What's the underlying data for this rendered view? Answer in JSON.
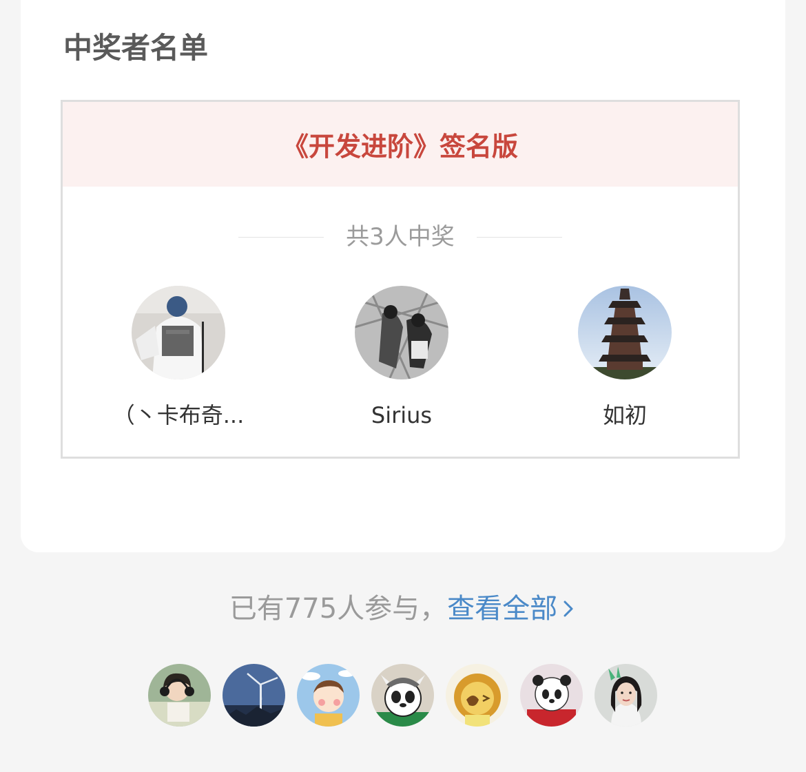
{
  "section_title": "中奖者名单",
  "prize": {
    "name": "《开发进阶》签名版",
    "winner_count_text": "共3人中奖"
  },
  "winners": [
    {
      "name": "（丶卡布奇...",
      "avatar": "avatar-photo-shirt"
    },
    {
      "name": "Sirius",
      "avatar": "avatar-manga-basketball"
    },
    {
      "name": "如初",
      "avatar": "avatar-pagoda"
    }
  ],
  "participation": {
    "text": "已有775人参与，",
    "link_label": "查看全部",
    "link_icon": "chevron-right-icon"
  },
  "participants": [
    {
      "avatar": "avatar-anime-headphones"
    },
    {
      "avatar": "avatar-wind-turbine"
    },
    {
      "avatar": "avatar-cartoon-kid"
    },
    {
      "avatar": "avatar-panda-hat"
    },
    {
      "avatar": "avatar-cartoon-lion"
    },
    {
      "avatar": "avatar-panda-red"
    },
    {
      "avatar": "avatar-girl-photo"
    }
  ],
  "colors": {
    "prize_title": "#c8473d",
    "prize_header_bg": "#fcf1f0",
    "link": "#4a89c8"
  }
}
